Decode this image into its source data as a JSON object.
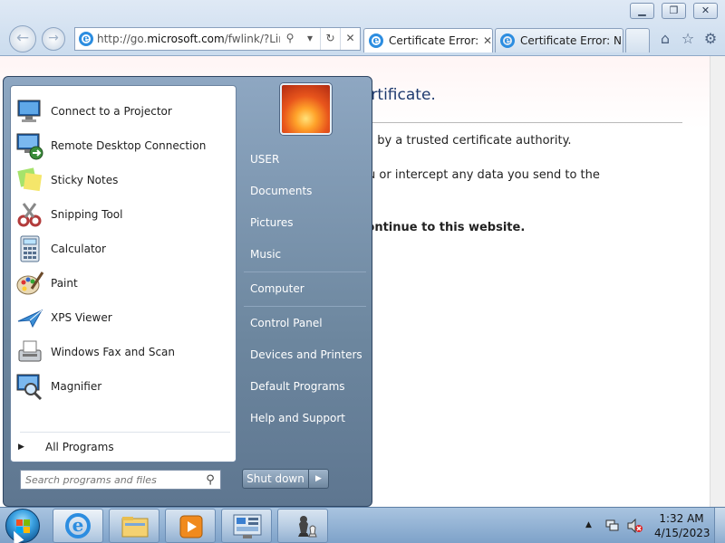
{
  "window": {
    "minimize_icon": "minimize-icon",
    "restore_icon": "restore-icon",
    "close_icon": "close-icon"
  },
  "browser": {
    "address": "http://go.microsoft.com/fwlink/?LinkI",
    "address_prefix": "http://go.",
    "address_host": "microsoft.com",
    "address_rest": "/fwlink/?LinkI",
    "tabs": [
      {
        "label": "Certificate Error:...",
        "active": true
      },
      {
        "label": "Certificate Error: N...",
        "active": false
      }
    ]
  },
  "page": {
    "title_fragment": "urity certificate.",
    "line1": "not issued by a trusted certificate authority.",
    "line2": "to fool you or intercept any data you send to the",
    "line3": "do not continue to this website."
  },
  "start_menu": {
    "programs": [
      {
        "label": "Connect to a Projector",
        "icon": "projector-icon"
      },
      {
        "label": "Remote Desktop Connection",
        "icon": "remote-desktop-icon"
      },
      {
        "label": "Sticky Notes",
        "icon": "sticky-notes-icon"
      },
      {
        "label": "Snipping Tool",
        "icon": "scissors-icon"
      },
      {
        "label": "Calculator",
        "icon": "calculator-icon"
      },
      {
        "label": "Paint",
        "icon": "palette-icon"
      },
      {
        "label": "XPS Viewer",
        "icon": "xps-viewer-icon"
      },
      {
        "label": "Windows Fax and Scan",
        "icon": "fax-icon"
      },
      {
        "label": "Magnifier",
        "icon": "magnifier-icon"
      }
    ],
    "all_programs": "All Programs",
    "search_placeholder": "Search programs and files",
    "right_items": {
      "user": "USER",
      "documents": "Documents",
      "pictures": "Pictures",
      "music": "Music",
      "computer": "Computer",
      "control_panel": "Control Panel",
      "devices_printers": "Devices and Printers",
      "default_programs": "Default Programs",
      "help_support": "Help and Support"
    },
    "shutdown": "Shut down"
  },
  "taskbar": {
    "time": "1:32 AM",
    "date": "4/15/2023",
    "pinned": [
      "internet-explorer-icon",
      "file-explorer-icon",
      "media-player-icon",
      "control-panel-icon",
      "chess-icon"
    ]
  },
  "colors": {
    "accent": "#2c8de0",
    "page_heading": "#1e3a6e"
  }
}
